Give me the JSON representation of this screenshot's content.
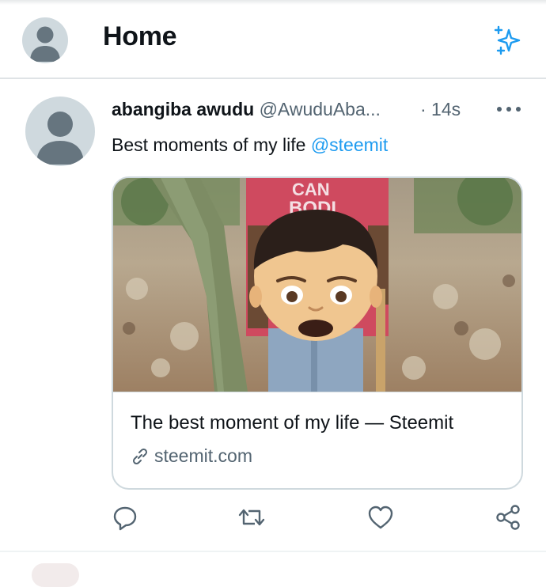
{
  "header": {
    "title": "Home",
    "sparkle_icon": "sparkle-icon",
    "accent": "#1d9bf0"
  },
  "tweet": {
    "author_name": "abangiba awudu",
    "author_handle": "@AwuduAba...",
    "time": "· 14s",
    "text_prefix": "Best moments of my life ",
    "mention": "@steemit",
    "card": {
      "title": "The best moment of my life — Steemit",
      "domain": "steemit.com"
    },
    "actions": [
      "reply-icon",
      "retweet-icon",
      "like-icon",
      "share-icon"
    ]
  }
}
